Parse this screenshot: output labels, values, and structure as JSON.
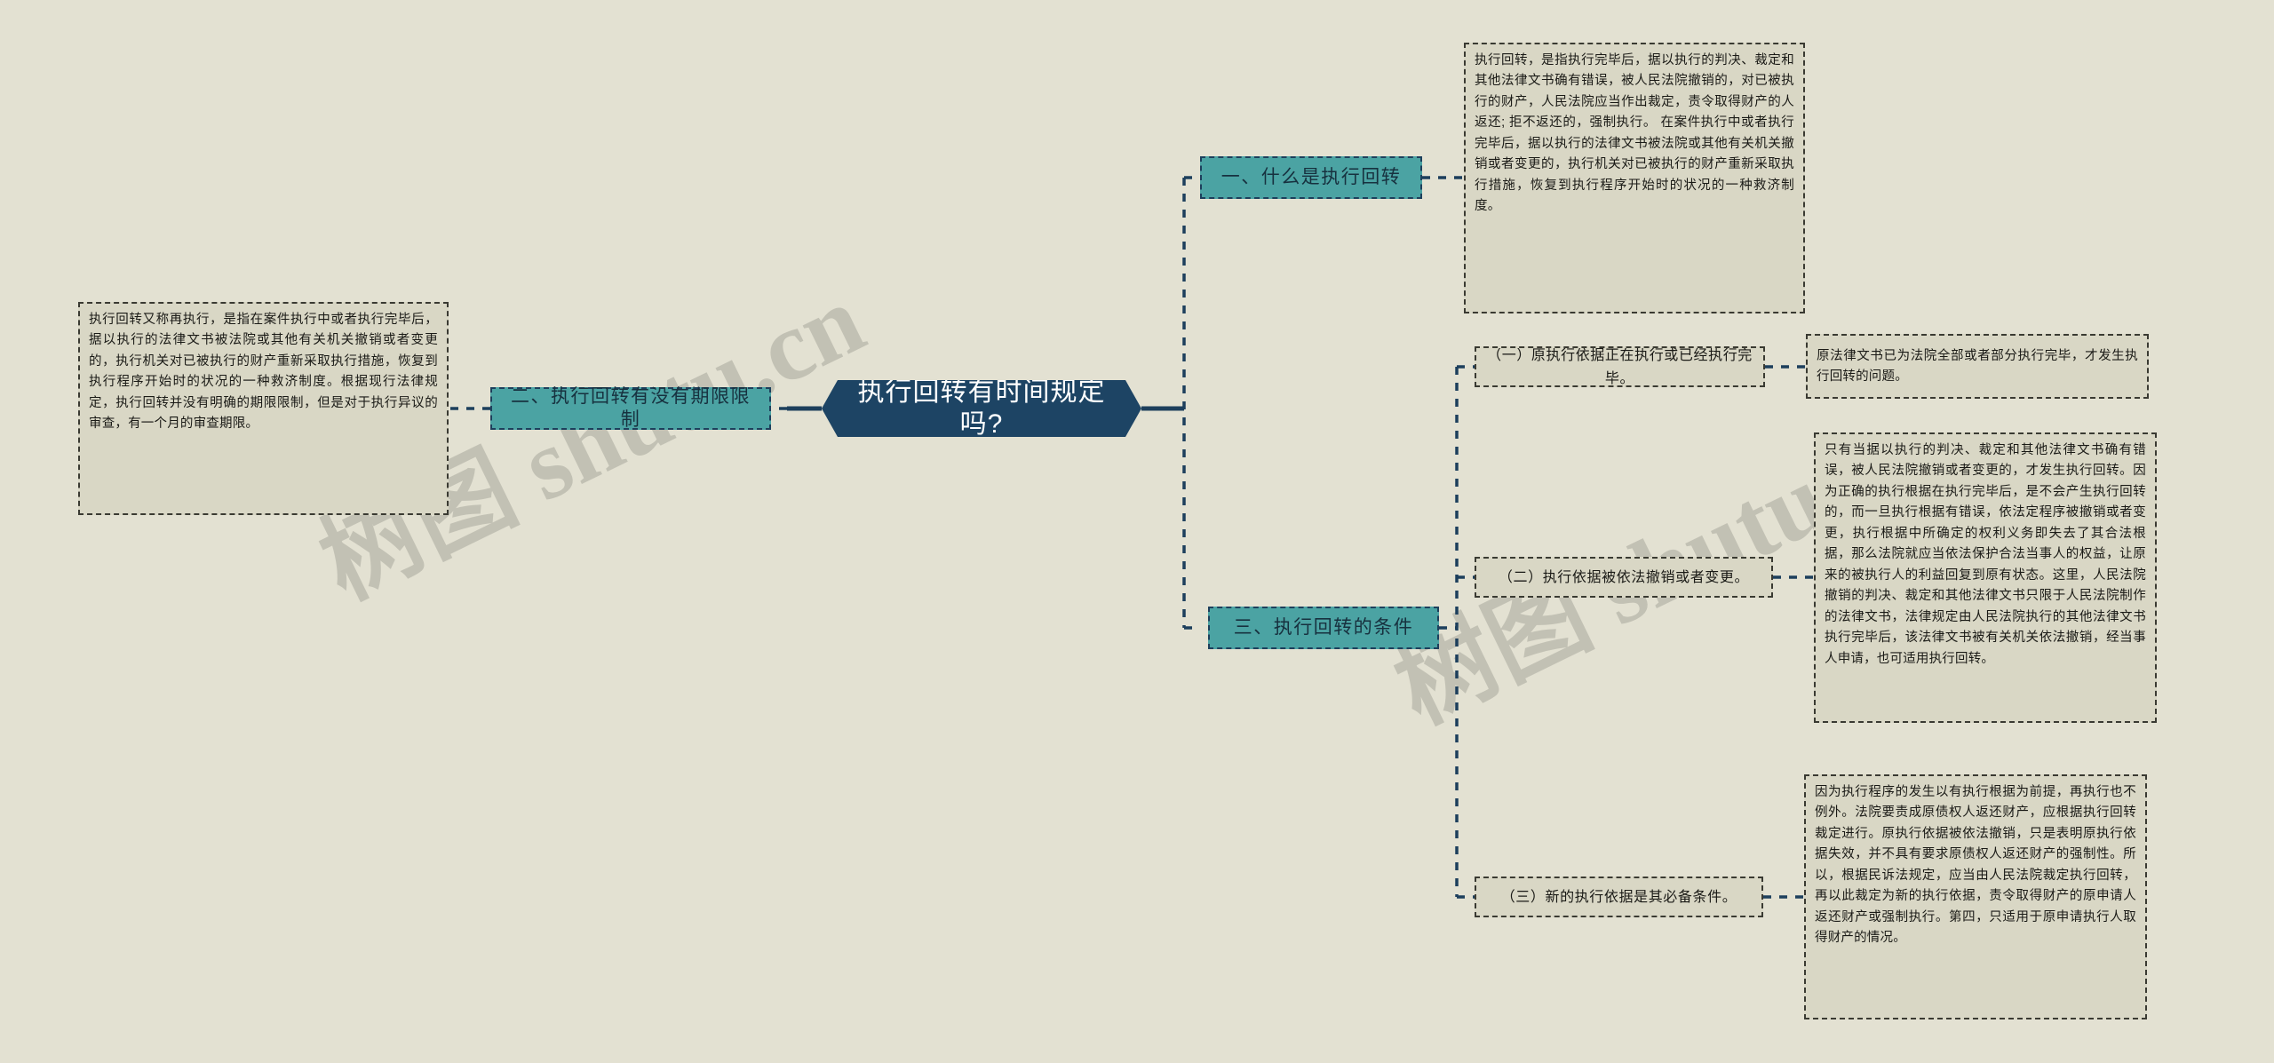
{
  "meta": {
    "background_color": "#e3e1d2",
    "central_color": "#1d4464",
    "branch_color": "#4ba3a3",
    "leaf_color": "#d9d7c5",
    "line_color": "#1d3f5c"
  },
  "watermark": {
    "left": "树图 shutu.cn",
    "right": "树图 shutu.cn"
  },
  "central": {
    "title": "执行回转有时间规定吗?"
  },
  "branches": [
    {
      "id": "b1",
      "label": "一、什么是执行回转",
      "leaves": [
        {
          "id": "b1-l1",
          "text": "执行回转，是指执行完毕后，据以执行的判决、裁定和其他法律文书确有错误，被人民法院撤销的，对已被执行的财产，人民法院应当作出裁定，责令取得财产的人返还; 拒不返还的，强制执行。 在案件执行中或者执行完毕后，据以执行的法律文书被法院或其他有关机关撤销或者变更的，执行机关对已被执行的财产重新采取执行措施，恢复到执行程序开始时的状况的一种救济制度。"
        }
      ]
    },
    {
      "id": "b2",
      "label": "二、执行回转有没有期限限制",
      "leaves": [
        {
          "id": "b2-l1",
          "text": "执行回转又称再执行，是指在案件执行中或者执行完毕后，据以执行的法律文书被法院或其他有关机关撤销或者变更的，执行机关对已被执行的财产重新采取执行措施，恢复到执行程序开始时的状况的一种救济制度。根据现行法律规定，执行回转并没有明确的期限限制，但是对于执行异议的审查，有一个月的审查期限。"
        }
      ]
    },
    {
      "id": "b3",
      "label": "三、执行回转的条件",
      "leaves": [
        {
          "id": "b3-l1",
          "text": "（一）原执行依据正在执行或已经执行完毕。",
          "children": [
            {
              "id": "b3-l1-c1",
              "text": "原法律文书已为法院全部或者部分执行完毕，才发生执行回转的问题。"
            }
          ]
        },
        {
          "id": "b3-l2",
          "text": "（二）执行依据被依法撤销或者变更。",
          "children": [
            {
              "id": "b3-l2-c1",
              "text": "只有当据以执行的判决、裁定和其他法律文书确有错误，被人民法院撤销或者变更的，才发生执行回转。因为正确的执行根据在执行完毕后，是不会产生执行回转的，而一旦执行根据有错误，依法定程序被撤销或者变更，执行根据中所确定的权利义务即失去了其合法根据，那么法院就应当依法保护合法当事人的权益，让原来的被执行人的利益回复到原有状态。这里，人民法院撤销的判决、裁定和其他法律文书只限于人民法院制作的法律文书，法律规定由人民法院执行的其他法律文书执行完毕后，该法律文书被有关机关依法撤销，经当事人申请，也可适用执行回转。"
            }
          ]
        },
        {
          "id": "b3-l3",
          "text": "（三）新的执行依据是其必备条件。",
          "children": [
            {
              "id": "b3-l3-c1",
              "text": "因为执行程序的发生以有执行根据为前提，再执行也不例外。法院要责成原债权人返还财产，应根据执行回转裁定进行。原执行依据被依法撤销，只是表明原执行依据失效，并不具有要求原债权人返还财产的强制性。所以，根据民诉法规定，应当由人民法院裁定执行回转，再以此裁定为新的执行依据，责令取得财产的原申请人返还财产或强制执行。第四，只适用于原申请执行人取得财产的情况。"
            }
          ]
        }
      ]
    }
  ]
}
